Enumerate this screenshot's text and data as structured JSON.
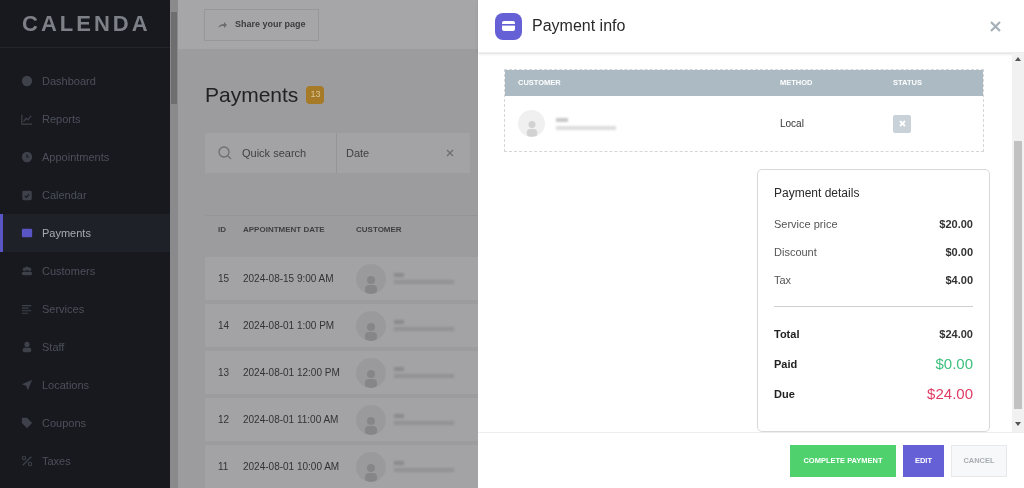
{
  "sidebar": {
    "logo": "CALENDA",
    "items": [
      {
        "label": "Dashboard",
        "selected": false
      },
      {
        "label": "Reports",
        "selected": false
      },
      {
        "label": "Appointments",
        "selected": false
      },
      {
        "label": "Calendar",
        "selected": false
      },
      {
        "label": "Payments",
        "selected": true
      },
      {
        "label": "Customers",
        "selected": false
      },
      {
        "label": "Services",
        "selected": false
      },
      {
        "label": "Staff",
        "selected": false
      },
      {
        "label": "Locations",
        "selected": false
      },
      {
        "label": "Coupons",
        "selected": false
      },
      {
        "label": "Taxes",
        "selected": false
      }
    ]
  },
  "topbar": {
    "share_button": "Share your page"
  },
  "page": {
    "title": "Payments",
    "count": "13",
    "filters": {
      "search_placeholder": "Quick search",
      "date_placeholder": "Date"
    },
    "table": {
      "columns": [
        "ID",
        "APPOINTMENT DATE",
        "CUSTOMER"
      ],
      "rows": [
        {
          "id": "15",
          "date": "2024-08-15 9:00 AM"
        },
        {
          "id": "14",
          "date": "2024-08-01 1:00 PM"
        },
        {
          "id": "13",
          "date": "2024-08-01 12:00 PM"
        },
        {
          "id": "12",
          "date": "2024-08-01 11:00 AM"
        },
        {
          "id": "11",
          "date": "2024-08-01 10:00 AM"
        }
      ]
    }
  },
  "modal": {
    "title": "Payment info",
    "customer_table": {
      "columns": [
        "CUSTOMER",
        "METHOD",
        "STATUS"
      ],
      "rows": [
        {
          "method": "Local",
          "kind": "cancelled"
        }
      ]
    },
    "details": {
      "title": "Payment details",
      "lines": [
        {
          "kind": "normal",
          "label": "Service price",
          "value": "$20.00"
        },
        {
          "kind": "normal",
          "label": "Discount",
          "value": "$0.00"
        },
        {
          "kind": "normal",
          "label": "Tax",
          "value": "$4.00"
        },
        {
          "kind": "total",
          "label": "Total",
          "value": "$24.00"
        },
        {
          "kind": "paid",
          "label": "Paid",
          "value": "$0.00"
        },
        {
          "kind": "due",
          "label": "Due",
          "value": "$24.00"
        }
      ]
    },
    "buttons": [
      {
        "kind": "success",
        "label": "COMPLETE PAYMENT"
      },
      {
        "kind": "primary",
        "label": "EDIT"
      },
      {
        "kind": "plain",
        "label": "CANCEL"
      }
    ]
  }
}
